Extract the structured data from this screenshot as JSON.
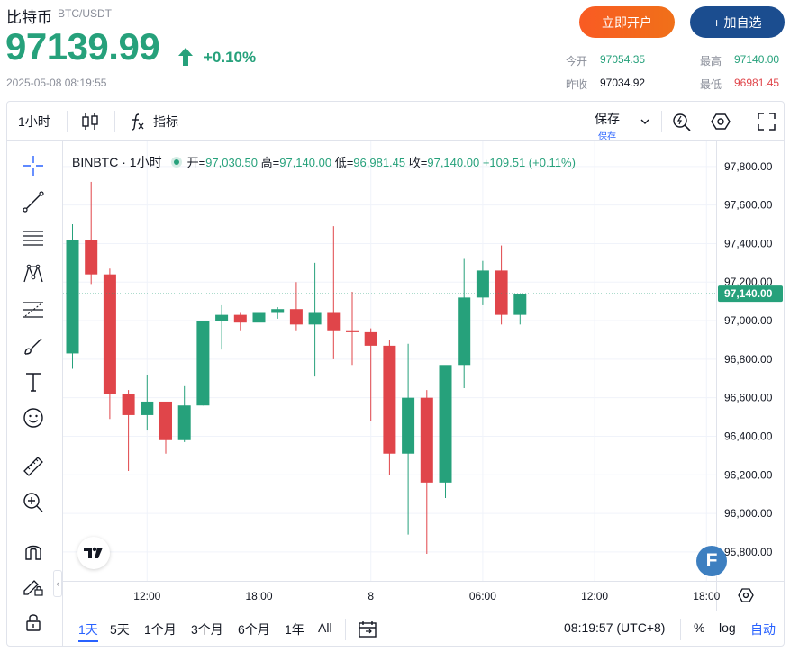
{
  "header": {
    "coin_name": "比特币",
    "pair": "BTC/USDT",
    "price": "97139.99",
    "change_pct": "+0.10%",
    "timestamp": "2025-05-08 08:19:55",
    "open_account_label": "立即开户",
    "add_watch_label": "+ 加自选",
    "stats": {
      "today_open_label": "今开",
      "today_open": "97054.35",
      "prev_close_label": "昨收",
      "prev_close": "97034.92",
      "high_label": "最高",
      "high": "97140.00",
      "low_label": "最低",
      "low": "96981.45"
    },
    "colors": {
      "up": "#26a17b",
      "down": "#e0454a",
      "open_btn": "#f95b23",
      "fav_btn": "#1b4d8f"
    }
  },
  "toolbar": {
    "interval": "1小时",
    "indicators_label": "指标",
    "save_label": "保存",
    "save_sub": "保存"
  },
  "left_tools": [
    "crosshair-icon",
    "trend-line-icon",
    "parallel-lines-icon",
    "pattern-icon",
    "fib-icon",
    "brush-icon",
    "text-icon",
    "emoji-icon",
    "ruler-icon",
    "zoom-in-icon",
    "magnet-icon",
    "lock-pencil-icon",
    "lock-icon"
  ],
  "legend": {
    "symbol": "BINBTC · 1小时",
    "open_label": "开=",
    "open": "97,030.50",
    "high_label": "高=",
    "high": "97,140.00",
    "low_label": "低=",
    "low": "96,981.45",
    "close_label": "收=",
    "close": "97,140.00",
    "change": "+109.51 (+0.11%)"
  },
  "bottom": {
    "ranges": [
      "1天",
      "5天",
      "1个月",
      "3个月",
      "6个月",
      "1年",
      "All"
    ],
    "active_range": "1天",
    "clock": "08:19:57 (UTC+8)",
    "pct_label": "%",
    "log_label": "log",
    "auto_label": "自动"
  },
  "chart_data": {
    "type": "candlestick",
    "interval": "1小时",
    "current_price": 97140.0,
    "current_price_label": "97,140.00",
    "y_ticks": [
      95800,
      96000,
      96200,
      96400,
      96600,
      96800,
      97000,
      97200,
      97400,
      97600,
      97800
    ],
    "y_tick_labels": [
      "95,800.00",
      "96,000.00",
      "96,200.00",
      "96,400.00",
      "96,600.00",
      "96,800.00",
      "97,000.00",
      "97,200.00",
      "97,400.00",
      "97,600.00",
      "97,800.00"
    ],
    "ylim": [
      95650,
      97930
    ],
    "x_tick_labels": [
      {
        "label": "12:00",
        "index": 4
      },
      {
        "label": "18:00",
        "index": 10
      },
      {
        "label": "8",
        "index": 16
      },
      {
        "label": "06:00",
        "index": 22
      },
      {
        "label": "12:00",
        "index": 28
      },
      {
        "label": "18:00",
        "index": 34
      }
    ],
    "candles": [
      {
        "o": 96830,
        "h": 97500,
        "l": 96750,
        "c": 97420
      },
      {
        "o": 97420,
        "h": 97720,
        "l": 97190,
        "c": 97240
      },
      {
        "o": 97240,
        "h": 97270,
        "l": 96490,
        "c": 96620
      },
      {
        "o": 96620,
        "h": 96640,
        "l": 96220,
        "c": 96510
      },
      {
        "o": 96510,
        "h": 96720,
        "l": 96430,
        "c": 96580
      },
      {
        "o": 96580,
        "h": 96580,
        "l": 96310,
        "c": 96380
      },
      {
        "o": 96380,
        "h": 96660,
        "l": 96370,
        "c": 96560
      },
      {
        "o": 96560,
        "h": 97000,
        "l": 96560,
        "c": 97000
      },
      {
        "o": 97000,
        "h": 97080,
        "l": 96850,
        "c": 97030
      },
      {
        "o": 97030,
        "h": 97040,
        "l": 96950,
        "c": 96990
      },
      {
        "o": 96990,
        "h": 97100,
        "l": 96930,
        "c": 97040
      },
      {
        "o": 97040,
        "h": 97070,
        "l": 97010,
        "c": 97060
      },
      {
        "o": 97060,
        "h": 97200,
        "l": 96950,
        "c": 96980
      },
      {
        "o": 96980,
        "h": 97300,
        "l": 96710,
        "c": 97040
      },
      {
        "o": 97040,
        "h": 97490,
        "l": 96800,
        "c": 96950
      },
      {
        "o": 96950,
        "h": 97150,
        "l": 96770,
        "c": 96940
      },
      {
        "o": 96940,
        "h": 96960,
        "l": 96480,
        "c": 96870
      },
      {
        "o": 96870,
        "h": 96900,
        "l": 96200,
        "c": 96310
      },
      {
        "o": 96310,
        "h": 96880,
        "l": 95890,
        "c": 96600
      },
      {
        "o": 96600,
        "h": 96640,
        "l": 95790,
        "c": 96160
      },
      {
        "o": 96160,
        "h": 96630,
        "l": 96080,
        "c": 96770
      },
      {
        "o": 96770,
        "h": 97320,
        "l": 96650,
        "c": 97120
      },
      {
        "o": 97120,
        "h": 97310,
        "l": 97080,
        "c": 97260
      },
      {
        "o": 97260,
        "h": 97390,
        "l": 96980,
        "c": 97030
      },
      {
        "o": 97030,
        "h": 97140,
        "l": 96980,
        "c": 97140
      }
    ]
  }
}
